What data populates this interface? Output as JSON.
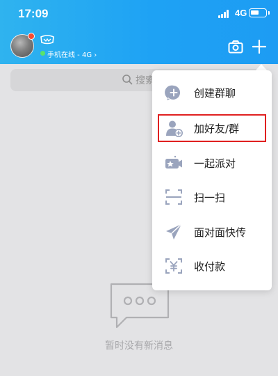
{
  "status_bar": {
    "time": "17:09",
    "network": "4G",
    "icons": [
      "signal-icon",
      "battery-icon"
    ]
  },
  "header": {
    "online_status": "手机在线 - 4G ›",
    "icons": [
      "avatar",
      "vip-icon",
      "camera-icon",
      "plus-icon"
    ],
    "colors": {
      "bar": "#1ea2f4",
      "online": "#59e36b",
      "badge": "#f74c31"
    }
  },
  "search": {
    "text": "搜索",
    "icon": "search-icon"
  },
  "menu": {
    "items": [
      {
        "label": "创建群聊",
        "icon": "create-group-icon"
      },
      {
        "label": "加好友/群",
        "icon": "add-friend-icon"
      },
      {
        "label": "一起派对",
        "icon": "party-icon"
      },
      {
        "label": "扫一扫",
        "icon": "scan-icon"
      },
      {
        "label": "面对面快传",
        "icon": "send-icon"
      },
      {
        "label": "收付款",
        "icon": "payment-icon"
      }
    ],
    "highlighted_item": "加好友/群",
    "colors": {
      "icon": "#9aa4bd",
      "highlight_border": "#e02020"
    }
  },
  "empty_state": {
    "text": "暂时没有新消息",
    "icon": "chat-bubble-icon"
  }
}
